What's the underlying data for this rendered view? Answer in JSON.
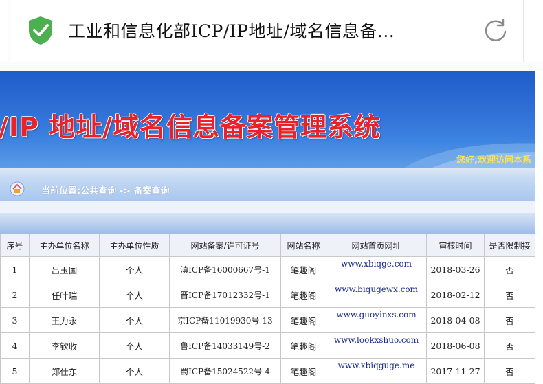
{
  "browser": {
    "page_title": "工业和信息化部ICP/IP地址/域名信息备...",
    "shield_icon": "shield-check-icon",
    "refresh_icon": "refresh-icon",
    "accent": "#4caf50"
  },
  "banner": {
    "title": "/IP 地址/域名信息备案管理系统",
    "welcome": "您好,欢迎访问本系",
    "title_color": "#e8222a",
    "bg_color": "#2f6fd6"
  },
  "breadcrumb": {
    "text": "当前位置:公共查询 -> 备案查询"
  },
  "table": {
    "headers": [
      "序号",
      "主办单位名称",
      "主办单位性质",
      "网站备案/许可证号",
      "网站名称",
      "网站首页网址",
      "审核时间",
      "是否限制接"
    ],
    "rows": [
      [
        "1",
        "吕玉国",
        "个人",
        "滇ICP备16000667号-1",
        "笔趣阁",
        "www.xbiqge.com",
        "2018-03-26",
        "否"
      ],
      [
        "2",
        "任叶瑞",
        "个人",
        "晋ICP备17012332号-1",
        "笔趣阁",
        "www.biqugewx.com",
        "2018-02-12",
        "否"
      ],
      [
        "3",
        "王力永",
        "个人",
        "京ICP备11019930号-13",
        "笔趣阁",
        "www.guoyinxs.com",
        "2018-04-08",
        "否"
      ],
      [
        "4",
        "李钦收",
        "个人",
        "鲁ICP备14033149号-2",
        "笔趣阁",
        "www.lookxshuo.com",
        "2018-06-08",
        "否"
      ],
      [
        "5",
        "郑仕东",
        "个人",
        "蜀ICP备15024522号-4",
        "笔趣阁",
        "www.xbiqguge.me",
        "2017-11-27",
        "否"
      ]
    ]
  }
}
